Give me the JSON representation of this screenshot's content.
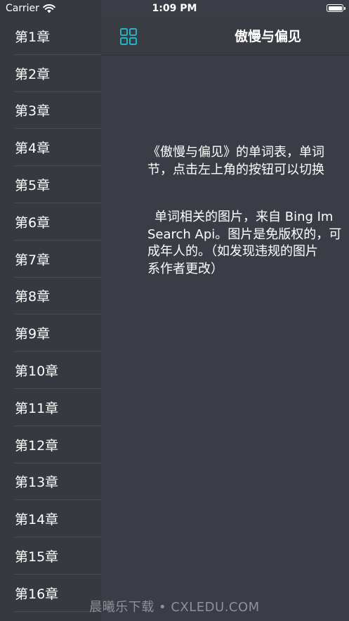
{
  "status_bar": {
    "carrier": "Carrier",
    "time": "1:09 PM"
  },
  "sidebar": {
    "chapters": [
      "第1章",
      "第2章",
      "第3章",
      "第4章",
      "第5章",
      "第6章",
      "第7章",
      "第8章",
      "第9章",
      "第10章",
      "第11章",
      "第12章",
      "第13章",
      "第14章",
      "第15章",
      "第16章"
    ]
  },
  "nav": {
    "title": "傲慢与偏见",
    "menu_icon": "grid-icon",
    "accent_color": "#1fb5c4"
  },
  "content": {
    "line1": "《傲慢与偏见》的单词表，单词",
    "line2": "节，点击左上角的按钮可以切换",
    "line3": "单词相关的图片，来自 Bing Im",
    "line4": "Search Api。图片是免版权的，可",
    "line5": "成年人的。（如发现违规的图片",
    "line6": "系作者更改）"
  },
  "watermark": "晨曦乐下载 • CXLEDU.COM"
}
